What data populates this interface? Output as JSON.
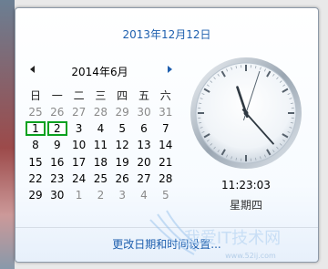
{
  "header": {
    "long_date": "2013年12月12日"
  },
  "calendar": {
    "month_title": "2014年6月",
    "prev_label": "previous-month",
    "next_label": "next-month",
    "weekdays": [
      "日",
      "一",
      "二",
      "三",
      "四",
      "五",
      "六"
    ],
    "weeks": [
      [
        {
          "d": "25",
          "other": true
        },
        {
          "d": "26",
          "other": true
        },
        {
          "d": "27",
          "other": true
        },
        {
          "d": "28",
          "other": true
        },
        {
          "d": "29",
          "other": true
        },
        {
          "d": "30",
          "other": true
        },
        {
          "d": "31",
          "other": true
        }
      ],
      [
        {
          "d": "1",
          "sel": true
        },
        {
          "d": "2",
          "sel": true
        },
        {
          "d": "3"
        },
        {
          "d": "4"
        },
        {
          "d": "5"
        },
        {
          "d": "6"
        },
        {
          "d": "7"
        }
      ],
      [
        {
          "d": "8"
        },
        {
          "d": "9"
        },
        {
          "d": "10"
        },
        {
          "d": "11"
        },
        {
          "d": "12"
        },
        {
          "d": "13"
        },
        {
          "d": "14"
        }
      ],
      [
        {
          "d": "15"
        },
        {
          "d": "16"
        },
        {
          "d": "17"
        },
        {
          "d": "18"
        },
        {
          "d": "19"
        },
        {
          "d": "20"
        },
        {
          "d": "21"
        }
      ],
      [
        {
          "d": "22"
        },
        {
          "d": "23"
        },
        {
          "d": "24"
        },
        {
          "d": "25"
        },
        {
          "d": "26"
        },
        {
          "d": "27"
        },
        {
          "d": "28"
        }
      ],
      [
        {
          "d": "29"
        },
        {
          "d": "30"
        },
        {
          "d": "1",
          "other": true
        },
        {
          "d": "2",
          "other": true
        },
        {
          "d": "3",
          "other": true
        },
        {
          "d": "4",
          "other": true
        },
        {
          "d": "5",
          "other": true
        }
      ]
    ]
  },
  "clock": {
    "time": "11:23:03",
    "weekday": "星期四",
    "hours": 11,
    "minutes": 23,
    "seconds": 3
  },
  "footer": {
    "change_link": "更改日期和时间设置..."
  },
  "watermark": {
    "text": "我爱IT技术网",
    "sub": "www.52ij.com"
  },
  "colors": {
    "accent": "#1e5fae",
    "selection": "#0aa11f"
  }
}
